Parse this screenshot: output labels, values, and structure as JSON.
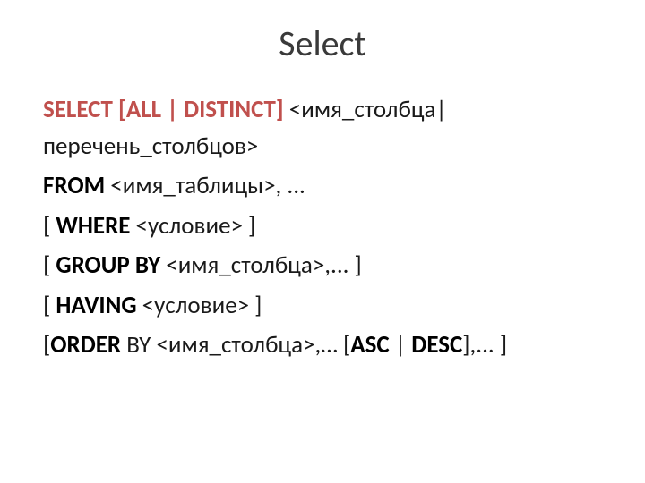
{
  "title": "Select",
  "line1": {
    "select": "SELECT",
    "bracket_open": "[",
    "all": "ALL",
    "pipe": " | ",
    "distinct": "DISTINCT",
    "bracket_close": "]",
    "rest": " <имя_столбца| перечень_столбцов>"
  },
  "line2": {
    "from": "FROM",
    "rest": " <имя_таблицы>, ..."
  },
  "line3": {
    "pre": "[ ",
    "where": "WHERE",
    "rest": " <условие> ]"
  },
  "line4": {
    "pre": "[ ",
    "groupby": "GROUP BY",
    "rest": " <имя_столбца>,... ]"
  },
  "line5": {
    "pre": "[ ",
    "having": "HAVING",
    "rest": " <условие> ]"
  },
  "line6": {
    "pre": "[",
    "order": "ORDER",
    "by": " BY ",
    "mid": "<имя_столбца>,… [",
    "asc": "ASC",
    "pipe": " | ",
    "desc": "DESC",
    "end": "],... ]"
  }
}
